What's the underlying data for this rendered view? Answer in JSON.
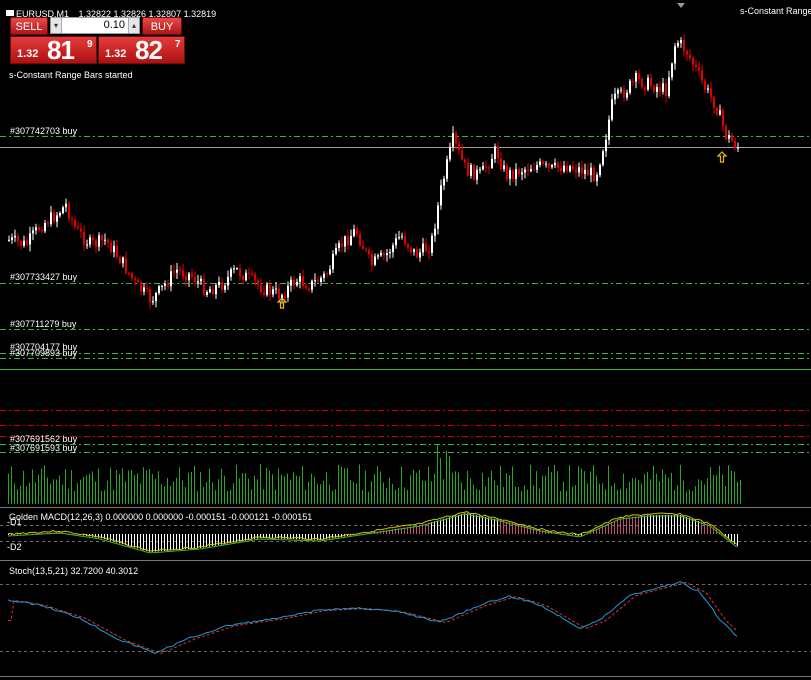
{
  "header": {
    "symbol_timeframe": "EURUSD,M1",
    "ohlc": "1.32822 1.32826 1.32807 1.32819",
    "indicator_name_right": "s-Constant Range",
    "started_message": "s-Constant Range Bars started"
  },
  "trade_panel": {
    "sell_label": "SELL",
    "buy_label": "BUY",
    "volume": "0.10",
    "bid_prefix": "1.32",
    "bid_big": "81",
    "bid_sup": "9",
    "ask_prefix": "1.32",
    "ask_big": "82",
    "ask_sup": "7"
  },
  "order_lines": [
    {
      "label": "#307742703 buy",
      "style": "dash-dot",
      "color": "#3cb43c"
    },
    {
      "label": "#307733427 buy",
      "style": "dash-dot",
      "color": "#3cb43c"
    },
    {
      "label": "#307711279 buy",
      "style": "dash-dot",
      "color": "#3cb43c"
    },
    {
      "label": "#307704177 buy",
      "style": "dash-dot",
      "color": "#3cb43c"
    },
    {
      "label": "#307709893 buy",
      "style": "dash-dot",
      "color": "#3cb43c"
    },
    {
      "label": "#307691562 buy",
      "style": "dash-dot",
      "color": "#3cb43c"
    },
    {
      "label": "#307691593 buy",
      "style": "dash-dot",
      "color": "#3cb43c"
    }
  ],
  "macd_panel": {
    "label": "Golden MACD(12,26,3) 0.000000 0.000000 -0.000151 -0.000121 -0.000151",
    "side_label_top": "-D1",
    "side_label_bottom": "-D2"
  },
  "stoch_panel": {
    "label": "Stoch(13,5,21) 32.7200 40.3012"
  },
  "colors": {
    "bull_candle": "#ffffff",
    "bear_candle": "#e00000",
    "order_line": "#3cb43c",
    "stop_line": "#e00000",
    "volume": "#22aa22",
    "stoch_main": "#1e9bd7",
    "stoch_signal": "#e03030",
    "arrow": "#f0c000"
  }
}
